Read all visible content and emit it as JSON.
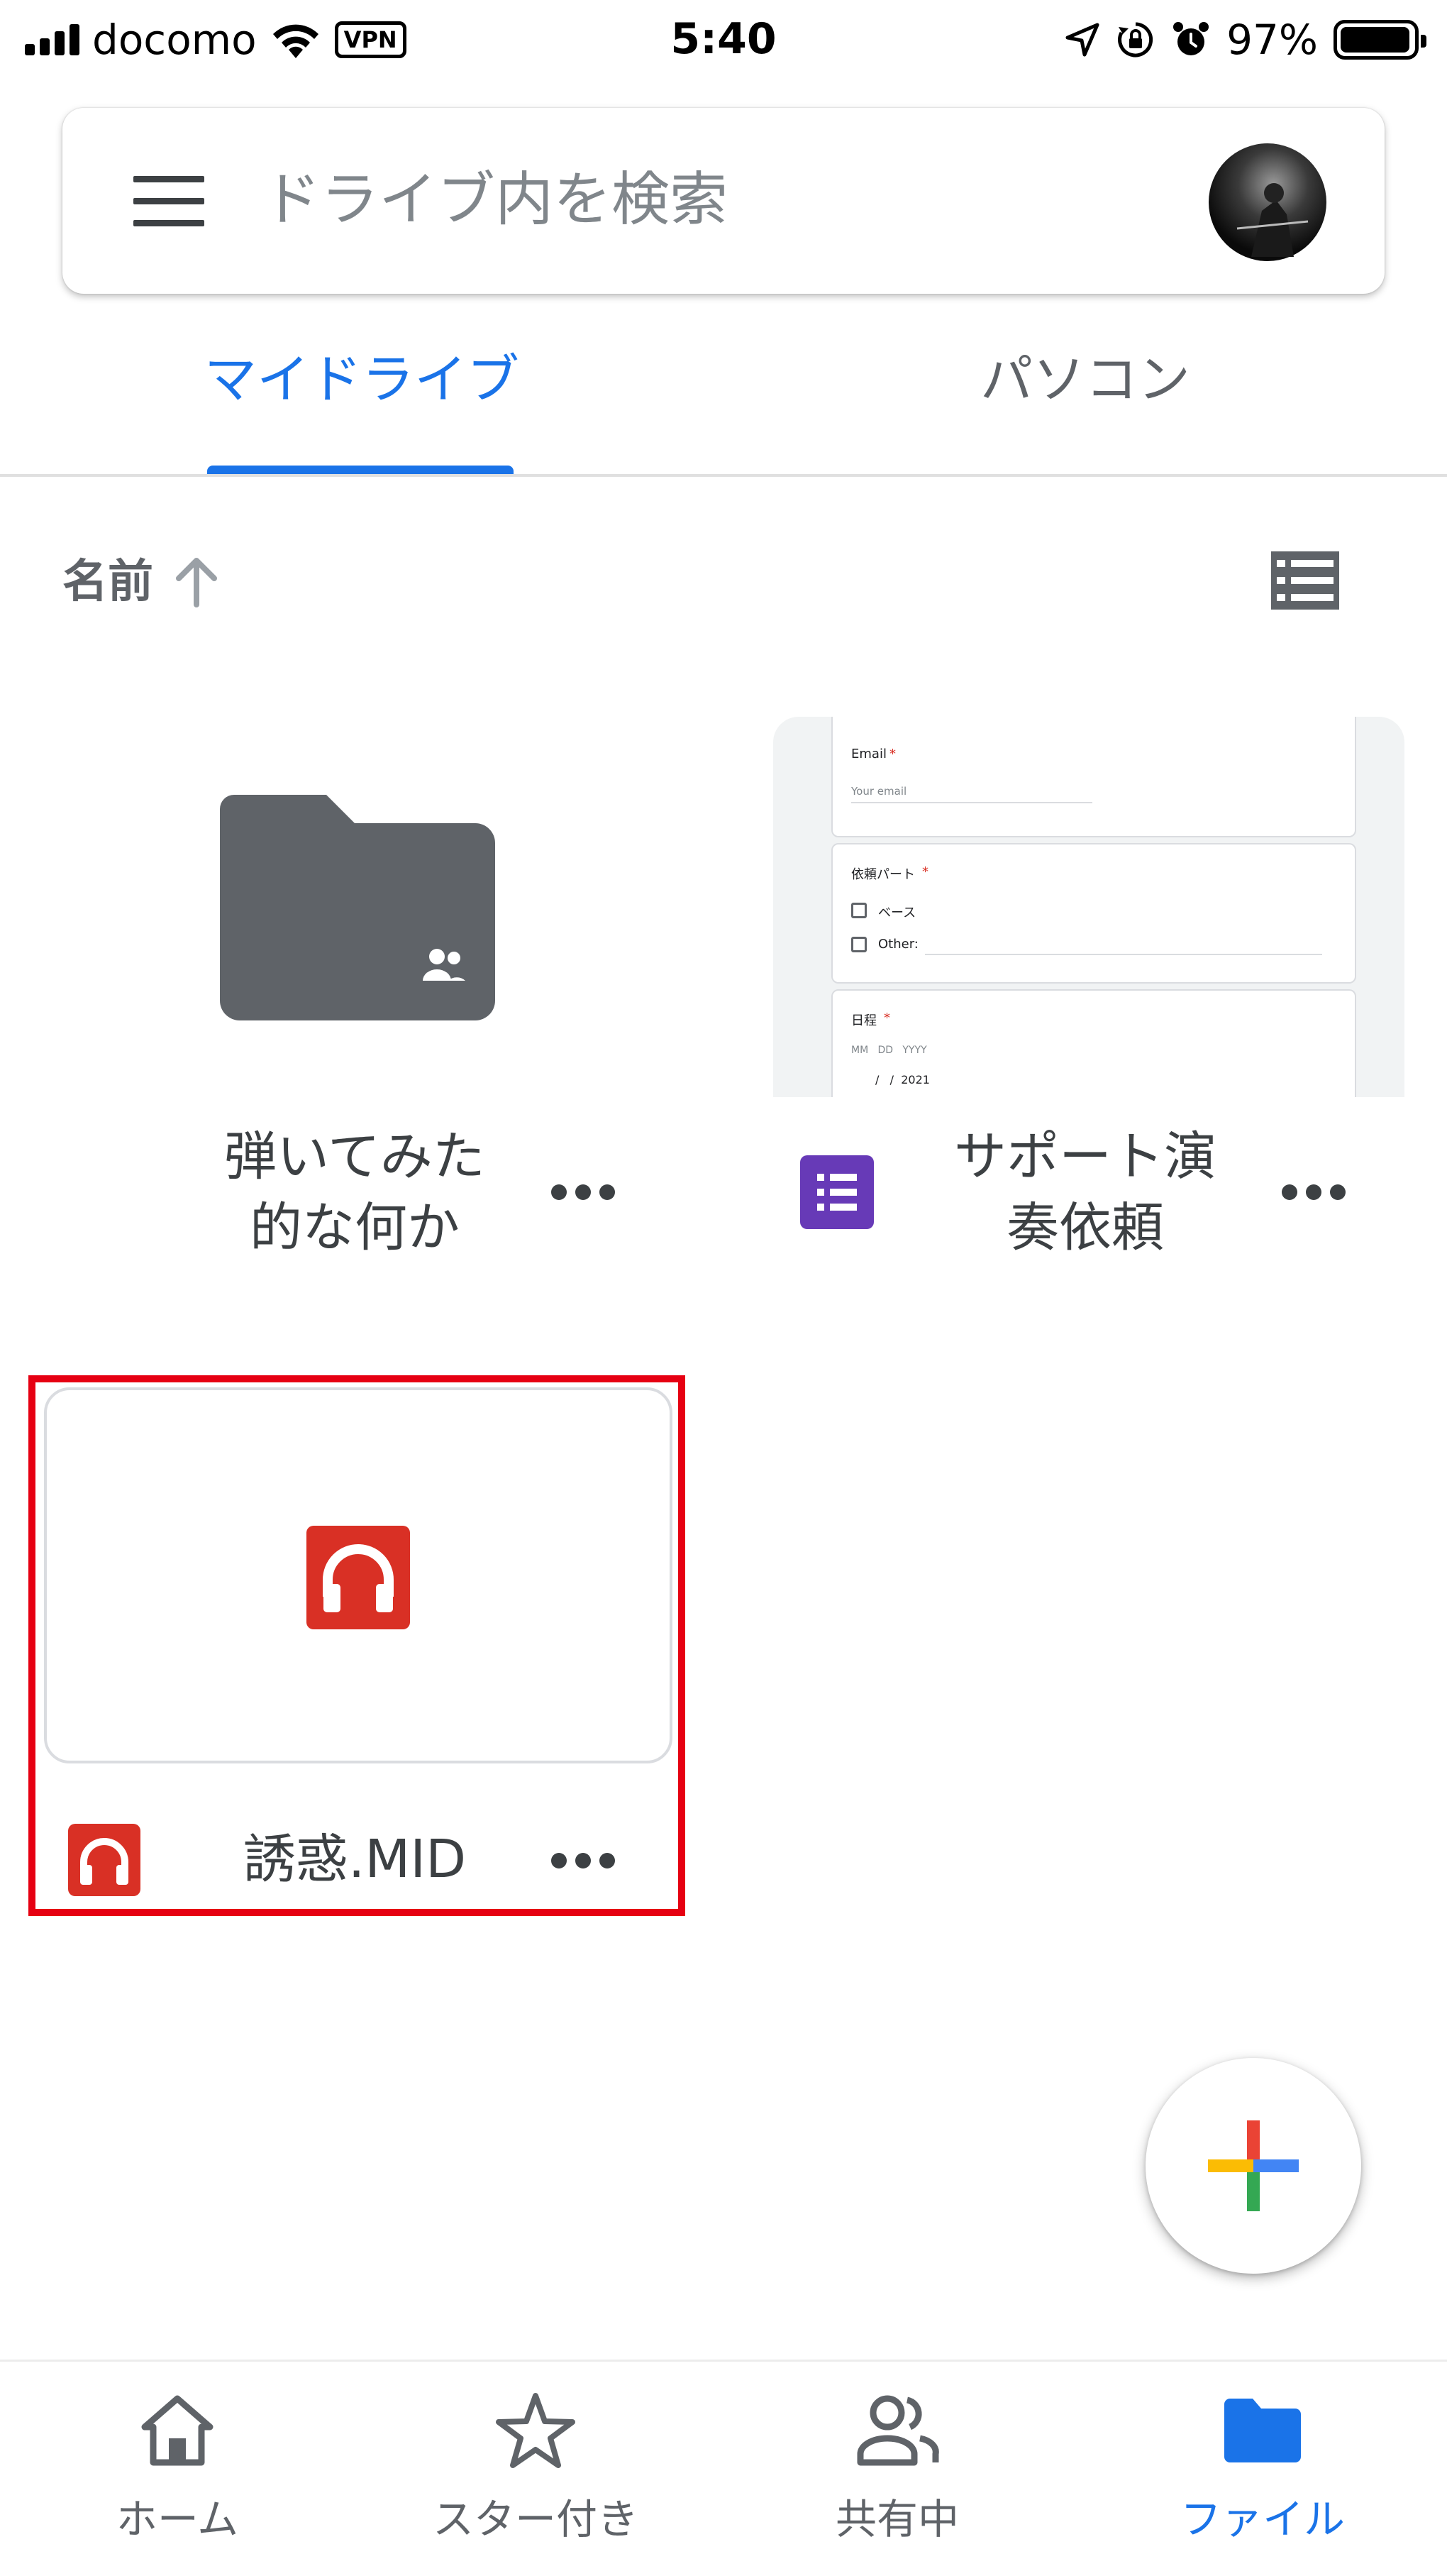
{
  "status_bar": {
    "carrier": "docomo",
    "vpn_label": "VPN",
    "time": "5:40",
    "battery_percent": "97%",
    "battery_level": 0.97,
    "icons": [
      "signal-icon",
      "wifi-icon",
      "location-arrow-icon",
      "rotation-lock-icon",
      "alarm-icon",
      "battery-icon"
    ]
  },
  "search": {
    "placeholder": "ドライブ内を検索"
  },
  "tabs": [
    {
      "label": "マイドライブ",
      "active": true
    },
    {
      "label": "パソコン",
      "active": false
    }
  ],
  "sort": {
    "label": "名前",
    "direction_icon": "arrow-up-icon",
    "view_toggle_icon": "list-view-icon"
  },
  "files": [
    {
      "name": "弾いてみた\n的な何か",
      "type": "shared-folder",
      "icon": "shared-folder-icon"
    },
    {
      "name": "サポート演\n奏依頼",
      "type": "google-form",
      "icon": "google-forms-icon",
      "preview": {
        "email_label": "Email",
        "email_placeholder": "Your email",
        "part_label": "依頼パート",
        "option_1": "ベース",
        "option_other": "Other:",
        "date_label": "日程",
        "date_fields": "MM   DD   YYYY",
        "date_value": "/   /  2021",
        "required_mark": "*"
      }
    },
    {
      "name": "誘惑.MID",
      "type": "audio",
      "icon": "audio-headphones-icon",
      "highlighted": true
    }
  ],
  "fab": {
    "icon": "plus-icon"
  },
  "bottom_nav": [
    {
      "label": "ホーム",
      "icon": "home-icon",
      "active": false
    },
    {
      "label": "スター付き",
      "icon": "star-icon",
      "active": false
    },
    {
      "label": "共有中",
      "icon": "people-icon",
      "active": false
    },
    {
      "label": "ファイル",
      "icon": "folder-icon",
      "active": true
    }
  ],
  "colors": {
    "accent_blue": "#1a73e8",
    "forms_purple": "#673ab7",
    "audio_red": "#d93025",
    "highlight_red": "#e60012",
    "folder_grey": "#5f6368"
  }
}
